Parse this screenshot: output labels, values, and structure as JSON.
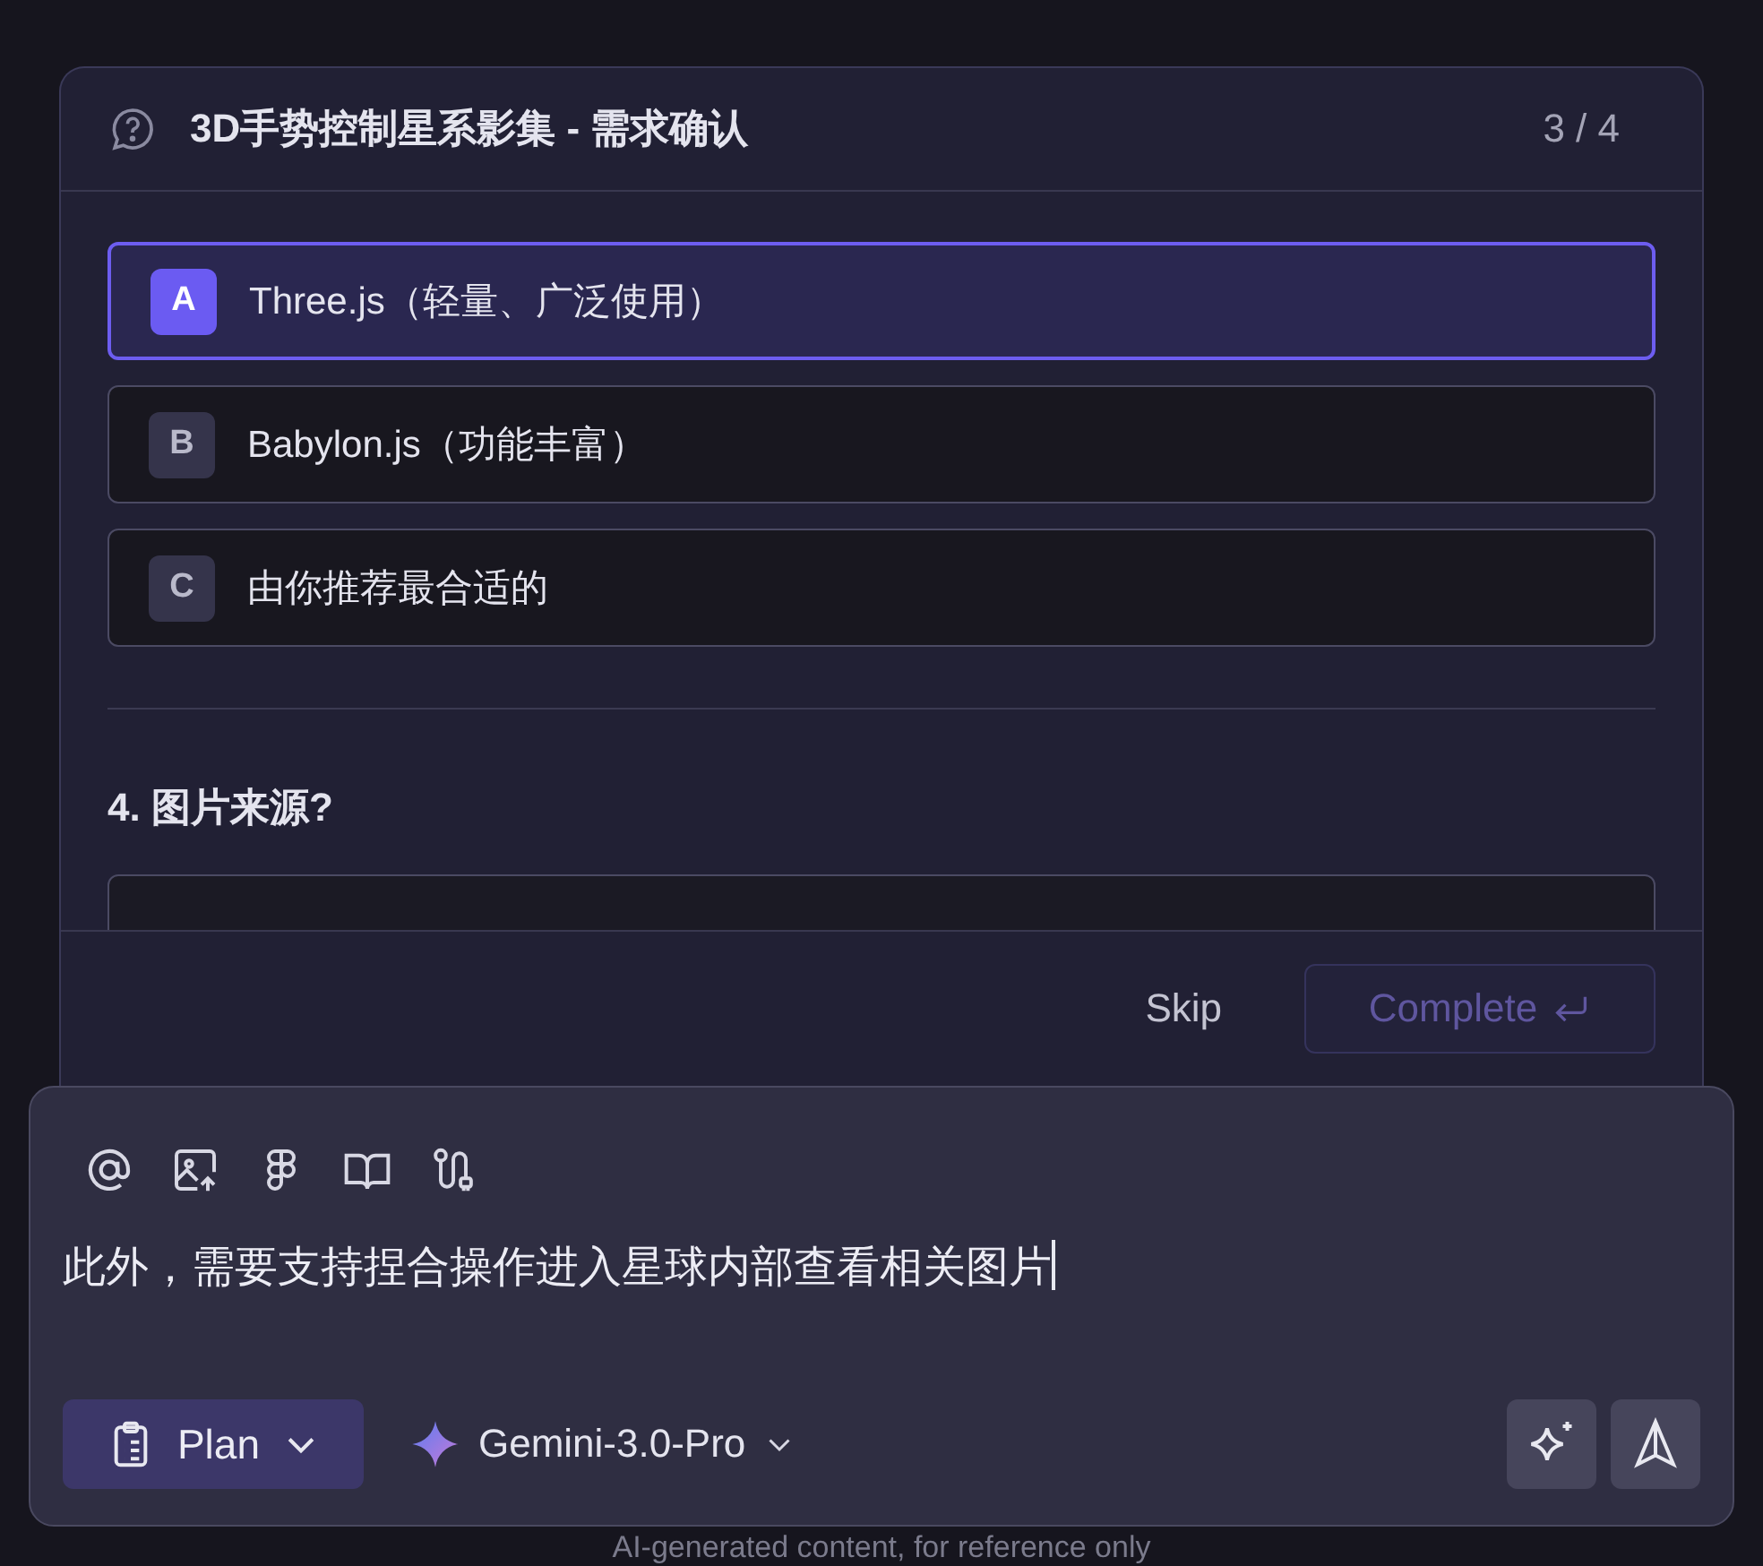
{
  "dialog": {
    "title": "3D手势控制星系影集 - 需求确认",
    "progress": "3 / 4",
    "options": [
      {
        "letter": "A",
        "label": "Three.js（轻量、广泛使用）",
        "selected": true
      },
      {
        "letter": "B",
        "label": "Babylon.js（功能丰富）",
        "selected": false
      },
      {
        "letter": "C",
        "label": "由你推荐最合适的",
        "selected": false
      }
    ],
    "next_question": "4. 图片来源?",
    "skip": "Skip",
    "complete": {
      "label": "Complete",
      "disabled": true
    }
  },
  "composer": {
    "text": "此外，需要支持捏合操作进入星球内部查看相关图片",
    "mode": "Plan",
    "model": "Gemini-3.0-Pro"
  },
  "disclaimer": "AI-generated content, for reference only"
}
